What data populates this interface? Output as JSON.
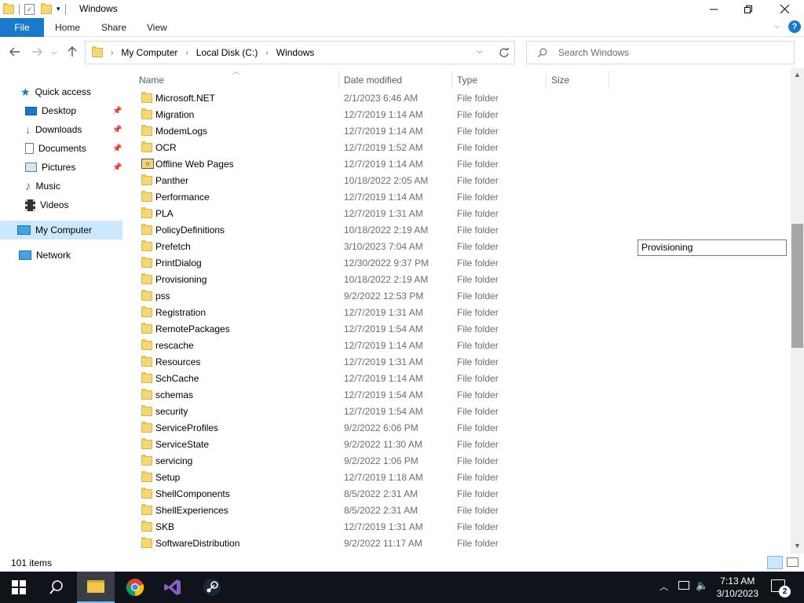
{
  "window": {
    "title": "Windows"
  },
  "ribbon": {
    "tabs": [
      "File",
      "Home",
      "Share",
      "View"
    ]
  },
  "address": {
    "crumbs": [
      "My Computer",
      "Local Disk (C:)",
      "Windows"
    ]
  },
  "search": {
    "placeholder": "Search Windows"
  },
  "nav": {
    "quick_access": "Quick access",
    "items": [
      "Desktop",
      "Downloads",
      "Documents",
      "Pictures",
      "Music",
      "Videos"
    ],
    "my_computer": "My Computer",
    "network": "Network"
  },
  "columns": {
    "name": "Name",
    "date": "Date modified",
    "type": "Type",
    "size": "Size"
  },
  "files": [
    {
      "name": "Microsoft.NET",
      "date": "2/1/2023 6:46 AM",
      "type": "File folder"
    },
    {
      "name": "Migration",
      "date": "12/7/2019 1:14 AM",
      "type": "File folder"
    },
    {
      "name": "ModemLogs",
      "date": "12/7/2019 1:14 AM",
      "type": "File folder"
    },
    {
      "name": "OCR",
      "date": "12/7/2019 1:52 AM",
      "type": "File folder"
    },
    {
      "name": "Offline Web Pages",
      "date": "12/7/2019 1:14 AM",
      "type": "File folder"
    },
    {
      "name": "Panther",
      "date": "10/18/2022 2:05 AM",
      "type": "File folder"
    },
    {
      "name": "Performance",
      "date": "12/7/2019 1:14 AM",
      "type": "File folder"
    },
    {
      "name": "PLA",
      "date": "12/7/2019 1:31 AM",
      "type": "File folder"
    },
    {
      "name": "PolicyDefinitions",
      "date": "10/18/2022 2:19 AM",
      "type": "File folder"
    },
    {
      "name": "Prefetch",
      "date": "3/10/2023 7:04 AM",
      "type": "File folder"
    },
    {
      "name": "PrintDialog",
      "date": "12/30/2022 9:37 PM",
      "type": "File folder"
    },
    {
      "name": "Provisioning",
      "date": "10/18/2022 2:19 AM",
      "type": "File folder"
    },
    {
      "name": "pss",
      "date": "9/2/2022 12:53 PM",
      "type": "File folder"
    },
    {
      "name": "Registration",
      "date": "12/7/2019 1:31 AM",
      "type": "File folder"
    },
    {
      "name": "RemotePackages",
      "date": "12/7/2019 1:54 AM",
      "type": "File folder"
    },
    {
      "name": "rescache",
      "date": "12/7/2019 1:14 AM",
      "type": "File folder"
    },
    {
      "name": "Resources",
      "date": "12/7/2019 1:31 AM",
      "type": "File folder"
    },
    {
      "name": "SchCache",
      "date": "12/7/2019 1:14 AM",
      "type": "File folder"
    },
    {
      "name": "schemas",
      "date": "12/7/2019 1:54 AM",
      "type": "File folder"
    },
    {
      "name": "security",
      "date": "12/7/2019 1:54 AM",
      "type": "File folder"
    },
    {
      "name": "ServiceProfiles",
      "date": "9/2/2022 6:06 PM",
      "type": "File folder"
    },
    {
      "name": "ServiceState",
      "date": "9/2/2022 11:30 AM",
      "type": "File folder"
    },
    {
      "name": "servicing",
      "date": "9/2/2022 1:06 PM",
      "type": "File folder"
    },
    {
      "name": "Setup",
      "date": "12/7/2019 1:18 AM",
      "type": "File folder"
    },
    {
      "name": "ShellComponents",
      "date": "8/5/2022 2:31 AM",
      "type": "File folder"
    },
    {
      "name": "ShellExperiences",
      "date": "8/5/2022 2:31 AM",
      "type": "File folder"
    },
    {
      "name": "SKB",
      "date": "12/7/2019 1:31 AM",
      "type": "File folder"
    },
    {
      "name": "SoftwareDistribution",
      "date": "9/2/2022 11:17 AM",
      "type": "File folder"
    }
  ],
  "rename_box": {
    "value": "Provisioning"
  },
  "status": {
    "count": "101 items"
  },
  "taskbar": {
    "time": "7:13 AM",
    "date": "3/10/2023",
    "notifications": "2"
  },
  "colors": {
    "accent": "#1979ca",
    "selection": "#cce8ff",
    "taskbar": "#101319"
  }
}
